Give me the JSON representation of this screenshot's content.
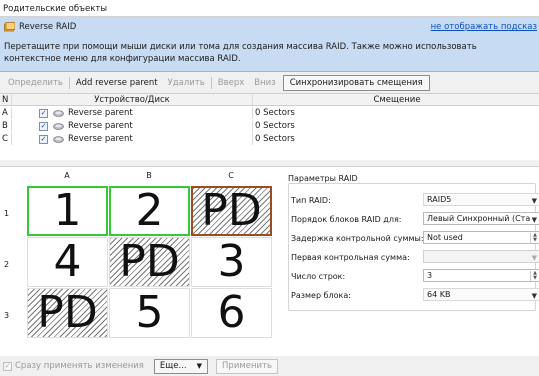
{
  "window": {
    "title": "Родительские объекты"
  },
  "hint": {
    "title": "Reverse RAID",
    "hide_link": "не отображать подсказ",
    "text": "Перетащите при помощи мыши диски или тома для создания массива RAID. Также можно использовать контекстное меню для конфигурации массива RAID."
  },
  "toolbar": {
    "define": "Определить",
    "add_reverse_parent": "Add reverse parent",
    "remove": "Удалить",
    "up": "Вверх",
    "down": "Вниз",
    "sync_offsets": "Синхронизировать смещения"
  },
  "table": {
    "headers": {
      "n": "N",
      "device": "Устройство/Диск",
      "offset": "Смещение"
    },
    "rows": [
      {
        "n": "A",
        "checked": "✓",
        "device": "Reverse parent",
        "offset": "0 Sectors"
      },
      {
        "n": "B",
        "checked": "✓",
        "device": "Reverse parent",
        "offset": "0 Sectors"
      },
      {
        "n": "C",
        "checked": "✓",
        "device": "Reverse parent",
        "offset": "0 Sectors"
      }
    ]
  },
  "raid_map": {
    "columns": [
      "A",
      "B",
      "C"
    ],
    "rows": [
      "1",
      "2",
      "3"
    ],
    "cells": [
      [
        "1",
        "2",
        "PD"
      ],
      [
        "4",
        "PD",
        "3"
      ],
      [
        "PD",
        "5",
        "6"
      ]
    ]
  },
  "params": {
    "title": "Параметры RAID",
    "raid_type_label": "Тип RAID:",
    "raid_type_value": "RAID5",
    "block_order_label": "Порядок блоков RAID для:",
    "block_order_value": "Левый Синхронный (Ста",
    "checksum_delay_label": "Задержка контрольной суммы:",
    "checksum_delay_value": "Not used",
    "first_checksum_label": "Первая контрольная сумма:",
    "first_checksum_value": "",
    "row_count_label": "Число строк:",
    "row_count_value": "3",
    "block_size_label": "Размер блока:",
    "block_size_value": "64 KB"
  },
  "bottom": {
    "apply_immediately": "Сразу применять изменения",
    "more": "Еще...",
    "apply": "Применить"
  },
  "colors": {
    "hint_bg": "#c7dbf3",
    "link": "#0b4fc6",
    "selected_green": "#35c935",
    "selected_brown": "#9d4b22"
  }
}
